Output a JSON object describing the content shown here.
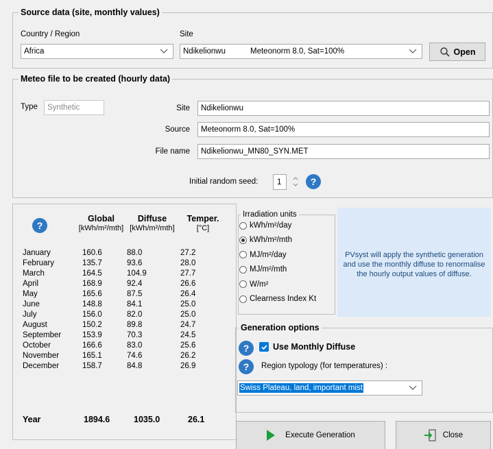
{
  "source_group": {
    "title": "Source data (site, monthly values)",
    "country_label": "Country / Region",
    "country_value": "Africa",
    "site_label": "Site",
    "site_value": "Ndikelionwu",
    "site_source": "Meteonorm 8.0, Sat=100%",
    "open_label": "Open"
  },
  "meteo_group": {
    "title": "Meteo file to be created (hourly data)",
    "type_label": "Type",
    "type_value": "Synthetic",
    "site_label": "Site",
    "site_value": "Ndikelionwu",
    "source_label": "Source",
    "source_value": "Meteonorm 8.0, Sat=100%",
    "filename_label": "File name",
    "filename_value": "Ndikelionwu_MN80_SYN.MET",
    "seed_label": "Initial random seed:",
    "seed_value": "1"
  },
  "table": {
    "headers": [
      "Global",
      "Diffuse",
      "Temper."
    ],
    "units": [
      "[kWh/m²/mth]",
      "[kWh/m²/mth]",
      "[°C]"
    ],
    "rows": [
      {
        "month": "January",
        "global": "160.6",
        "diffuse": "88.0",
        "temp": "27.2"
      },
      {
        "month": "February",
        "global": "135.7",
        "diffuse": "93.6",
        "temp": "28.0"
      },
      {
        "month": "March",
        "global": "164.5",
        "diffuse": "104.9",
        "temp": "27.7"
      },
      {
        "month": "April",
        "global": "168.9",
        "diffuse": "92.4",
        "temp": "26.6"
      },
      {
        "month": "May",
        "global": "165.6",
        "diffuse": "87.5",
        "temp": "26.4"
      },
      {
        "month": "June",
        "global": "148.8",
        "diffuse": "84.1",
        "temp": "25.0"
      },
      {
        "month": "July",
        "global": "156.0",
        "diffuse": "82.0",
        "temp": "25.0"
      },
      {
        "month": "August",
        "global": "150.2",
        "diffuse": "89.8",
        "temp": "24.7"
      },
      {
        "month": "September",
        "global": "153.9",
        "diffuse": "70.3",
        "temp": "24.5"
      },
      {
        "month": "October",
        "global": "166.6",
        "diffuse": "83.0",
        "temp": "25.6"
      },
      {
        "month": "November",
        "global": "165.1",
        "diffuse": "74.6",
        "temp": "26.2"
      },
      {
        "month": "December",
        "global": "158.7",
        "diffuse": "84.8",
        "temp": "26.9"
      }
    ],
    "year": {
      "label": "Year",
      "global": "1894.6",
      "diffuse": "1035.0",
      "temp": "26.1"
    }
  },
  "irradiation_units": {
    "title": "Irradiation units",
    "options": [
      "kWh/m²/day",
      "kWh/m²/mth",
      "MJ/m²/day",
      "MJ/m²/mth",
      "W/m²",
      "Clearness Index Kt"
    ],
    "selected": "kWh/m²/mth"
  },
  "info_text": "PVsyst will apply the synthetic generation and use the monthly diffuse to renormalise the hourly output values of diffuse.",
  "generation_options": {
    "title": "Generation options",
    "use_monthly_diffuse_label": "Use Monthly Diffuse",
    "use_monthly_diffuse_checked": true,
    "region_typology_label": "Region typology (for temperatures) :",
    "region_typology_value": "Swiss Plateau, land, important mist"
  },
  "buttons": {
    "execute_label": "Execute Generation",
    "close_label": "Close"
  },
  "colors": {
    "help_blue": "#2f78c4",
    "info_bg": "#dbe9f9",
    "selection_blue": "#0078d7",
    "execute_green": "#1e9e3a"
  }
}
